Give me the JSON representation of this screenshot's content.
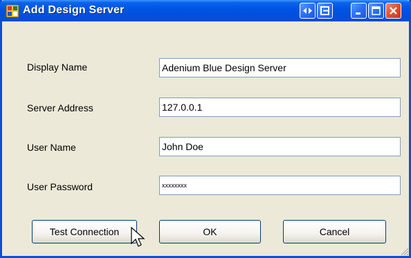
{
  "window": {
    "title": "Add Design Server",
    "controls": {
      "extra_icons": [
        "double-arrow-icon",
        "export-icon"
      ],
      "minimize": "minimize-icon",
      "maximize": "maximize-icon",
      "close": "close-icon"
    }
  },
  "form": {
    "display_name": {
      "label": "Display Name",
      "value": "Adenium Blue Design Server"
    },
    "server_address": {
      "label": "Server Address",
      "value": "127.0.0.1"
    },
    "user_name": {
      "label": "User Name",
      "value": "John Doe"
    },
    "user_password": {
      "label": "User Password",
      "value": "xxxxxxxx"
    }
  },
  "buttons": {
    "test_connection": "Test Connection",
    "ok": "OK",
    "cancel": "Cancel"
  },
  "colors": {
    "title_bar": "#0054e3",
    "dialog_bg": "#ece9d8",
    "field_border": "#7f9db9",
    "close_button": "#e0522f"
  }
}
